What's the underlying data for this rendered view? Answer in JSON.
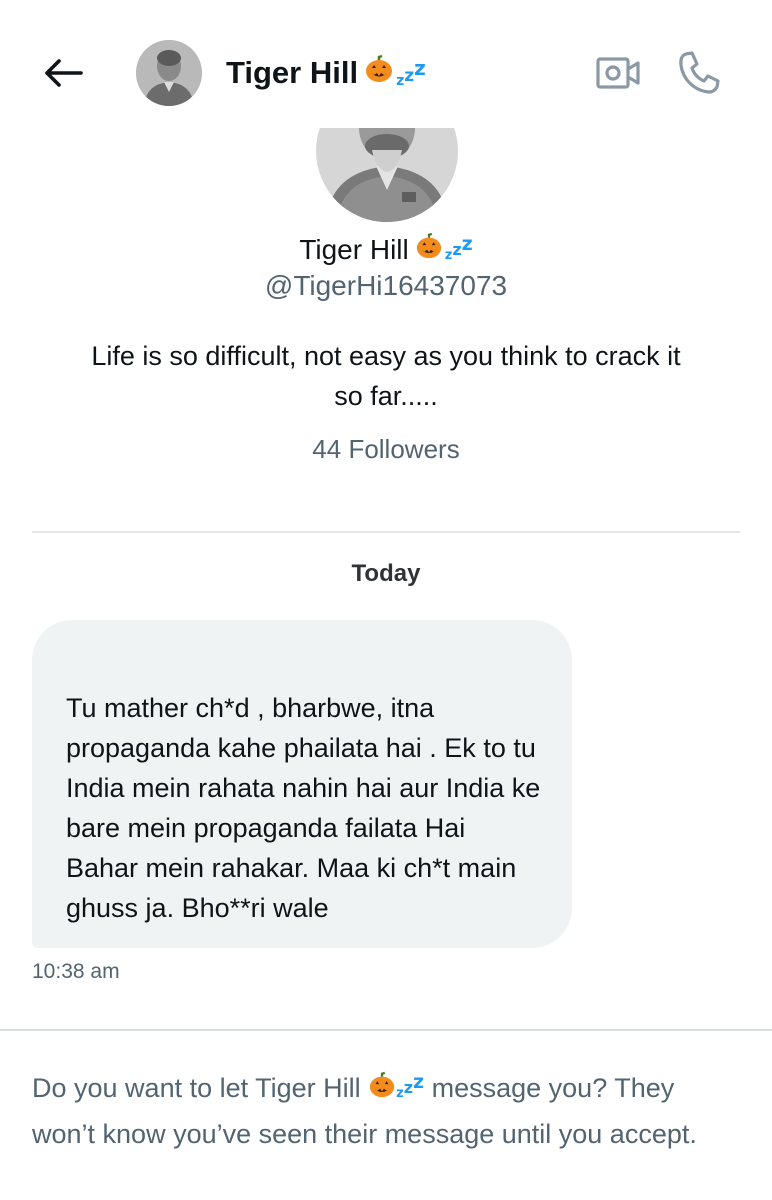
{
  "header": {
    "title": "Tiger Hill",
    "emoji": [
      "pumpkin-icon",
      "zzz-icon"
    ]
  },
  "profile": {
    "name": "Tiger Hill",
    "handle": "@TigerHi16437073",
    "bio": "Life is so difficult, not easy as you think to crack it so far.....",
    "followers": "44 Followers"
  },
  "conversation": {
    "day_label": "Today",
    "messages": [
      {
        "text": "Tu mather ch*d , bharbwe, itna propaganda kahe  phailata hai . Ek to tu India mein rahata nahin hai aur India ke bare mein propaganda failata Hai Bahar mein rahakar. Maa ki ch*t main ghuss ja. Bho**ri wale",
        "time": "10:38 am"
      }
    ]
  },
  "request": {
    "prefix": "Do you want to let Tiger Hill",
    "suffix": " message you? They won’t know you’ve seen their message until you accept."
  },
  "colors": {
    "accent": "#1d9bf0",
    "secondary_text": "#536471",
    "bubble_bg": "#eff3f4",
    "pumpkin": "#f28c1c"
  }
}
